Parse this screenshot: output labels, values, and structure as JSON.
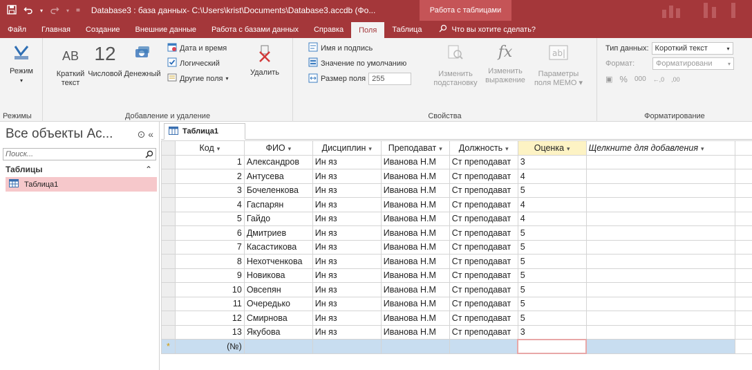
{
  "titlebar": {
    "title": "Database3 : база данных- C:\\Users\\krist\\Documents\\Database3.accdb (Фо...",
    "context": "Работа с таблицами"
  },
  "tabs": [
    {
      "label": "Файл"
    },
    {
      "label": "Главная"
    },
    {
      "label": "Создание"
    },
    {
      "label": "Внешние данные"
    },
    {
      "label": "Работа с базами данных"
    },
    {
      "label": "Справка"
    },
    {
      "label": "Поля"
    },
    {
      "label": "Таблица"
    }
  ],
  "search_tab": "Что вы хотите сделать?",
  "ribbon": {
    "mode_group": {
      "button": "Режим",
      "label": "Режимы"
    },
    "add_group": {
      "short_text": "Краткий",
      "short_text2": "текст",
      "number": "Числовой",
      "currency": "Денежный",
      "ab_glyph": "AB",
      "num_glyph": "12",
      "date_time": "Дата и время",
      "logical": "Логический",
      "other": "Другие поля",
      "delete": "Удалить",
      "label": "Добавление и удаление"
    },
    "props_group": {
      "name_caption": "Имя и подпись",
      "default_value": "Значение по умолчанию",
      "field_size": "Размер поля",
      "field_size_value": "255",
      "modify_lookup": "Изменить",
      "modify_lookup2": "подстановку",
      "modify_expr": "Изменить",
      "modify_expr2": "выражение",
      "memo": "Параметры",
      "memo2": "поля MEMO",
      "label": "Свойства"
    },
    "format_group": {
      "data_type_label": "Тип данных:",
      "data_type_value": "Короткий текст",
      "format_label": "Формат:",
      "format_value": "Форматировани",
      "label": "Форматирование"
    }
  },
  "nav": {
    "title": "Все объекты Ac...",
    "search_placeholder": "Поиск...",
    "group": "Таблицы",
    "item": "Таблица1"
  },
  "doc_tab": "Таблица1",
  "table": {
    "columns": [
      "Код",
      "ФИО",
      "Дисциплин",
      "Преподават",
      "Должность",
      "Оценка",
      "Щелкните для добавления"
    ],
    "rows": [
      [
        "1",
        "Александров",
        "Ин яз",
        "Иванова Н.М",
        "Ст преподават",
        "3"
      ],
      [
        "2",
        "Антусева",
        "Ин яз",
        "Иванова Н.М",
        "Ст преподават",
        "4"
      ],
      [
        "3",
        "Бочеленкова",
        "Ин яз",
        "Иванова Н.М",
        "Ст преподават",
        "5"
      ],
      [
        "4",
        "Гаспарян",
        "Ин яз",
        "Иванова Н.М",
        "Ст преподават",
        "4"
      ],
      [
        "5",
        "Гайдо",
        "Ин яз",
        "Иванова Н.М",
        "Ст преподават",
        "4"
      ],
      [
        "6",
        "Дмитриев",
        "Ин яз",
        "Иванова Н.М",
        "Ст преподават",
        "5"
      ],
      [
        "7",
        "Касастикова",
        "Ин яз",
        "Иванова Н.М",
        "Ст преподават",
        "5"
      ],
      [
        "8",
        "Нехотченкова",
        "Ин яз",
        "Иванова Н.М",
        "Ст преподават",
        "5"
      ],
      [
        "9",
        "Новикова",
        "Ин яз",
        "Иванова Н.М",
        "Ст преподават",
        "5"
      ],
      [
        "10",
        "Овсепян",
        "Ин яз",
        "Иванова Н.М",
        "Ст преподават",
        "5"
      ],
      [
        "11",
        "Очередько",
        "Ин яз",
        "Иванова Н.М",
        "Ст преподават",
        "5"
      ],
      [
        "12",
        "Смирнова",
        "Ин яз",
        "Иванова Н.М",
        "Ст преподават",
        "5"
      ],
      [
        "13",
        "Якубова",
        "Ин яз",
        "Иванова Н.М",
        "Ст преподават",
        "3"
      ]
    ],
    "new_row_marker": "*",
    "new_row_code": "(№)"
  },
  "colors": {
    "brand": "#a4373a",
    "context": "#c55457",
    "new_row": "#c8ddf0",
    "selected_nav": "#f6c8cb"
  }
}
